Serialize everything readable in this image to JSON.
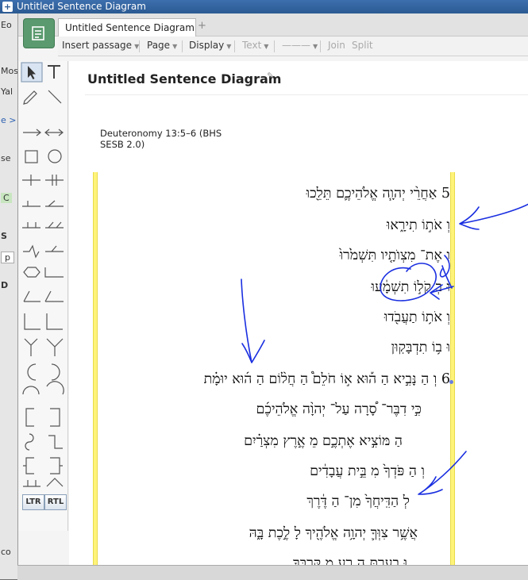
{
  "window": {
    "title": "Untitled Sentence Diagram"
  },
  "background_window": {
    "fragments": [
      "Eo",
      "Mos",
      "Yal",
      "e >",
      "se",
      "C",
      "S",
      "p",
      "D",
      "co"
    ]
  },
  "tabs": [
    {
      "label": "Untitled Sentence Diagram"
    }
  ],
  "tab_add": "+",
  "toolbar": {
    "insert_passage": "Insert passage",
    "page": "Page",
    "display": "Display",
    "text": "Text",
    "line": "———",
    "join": "Join",
    "split": "Split"
  },
  "palette": {
    "select_icon": "arrow-cursor-icon",
    "text_tool": "T",
    "ltr": "LTR",
    "rtl": "RTL"
  },
  "diagram": {
    "title": "Untitled Sentence Diagram",
    "reference": "Deuteronomy 13:5–6 (BHS SESB 2.0)",
    "lines": [
      "5 אַחֲרֵ֨י יְהוָ֧ה אֱלֹהֵיכֶ֛ם תֵּלֵ֖כוּ",
      "וְ אֹת֣וֹ תִירָ֑אוּ",
      "וְ אֶת־ מִצְוֺתָ֤יו תִּשְׁמֹ֙רוּ֙",
      "וּ בְ קֹל֣וֹ תִשְׁמָ֔עוּ",
      "וְ אֹת֥וֹ תַעֲבֹ֖דוּ",
      "וּ ב֥וֹ תִדְבָּקֽוּן",
      "6 וְ הַ נָּבִ֣יא הַ ה֡וּא א֣וֹ חֹלֵם֩ הַ חֲל֨וֹם הַ ה֜וּא יוּמָ֗ת",
      "כִּ֣י דִבֶּר־ סָ֠רָה עַל־ יְהוָ֨ה אֱלֹהֵיכֶ֜ם",
      "הַ מּוֹצִ֣יא אֶתְכֶ֣ם מֵ אֶ֣רֶץ מִצְרַ֗יִם",
      "וְ הַ פֹּדְךָ֙ מִ בֵּ֣ית עֲבָדִ֔ים",
      "לְ הַדִּֽיחֲךָ֙ מִן־ הַ דֶּ֔רֶךְ",
      "אֲשֶׁ֥ר צִוְּךָ֛ יְהוָ֥ה אֱלֹהֶ֖יךָ לָ לֶ֣כֶת בָּ֑הּ",
      "וּ בִֽעַרְתָּ֥ הָ רָ֖ע מִ קִּרְבֶּֽךָ"
    ]
  }
}
